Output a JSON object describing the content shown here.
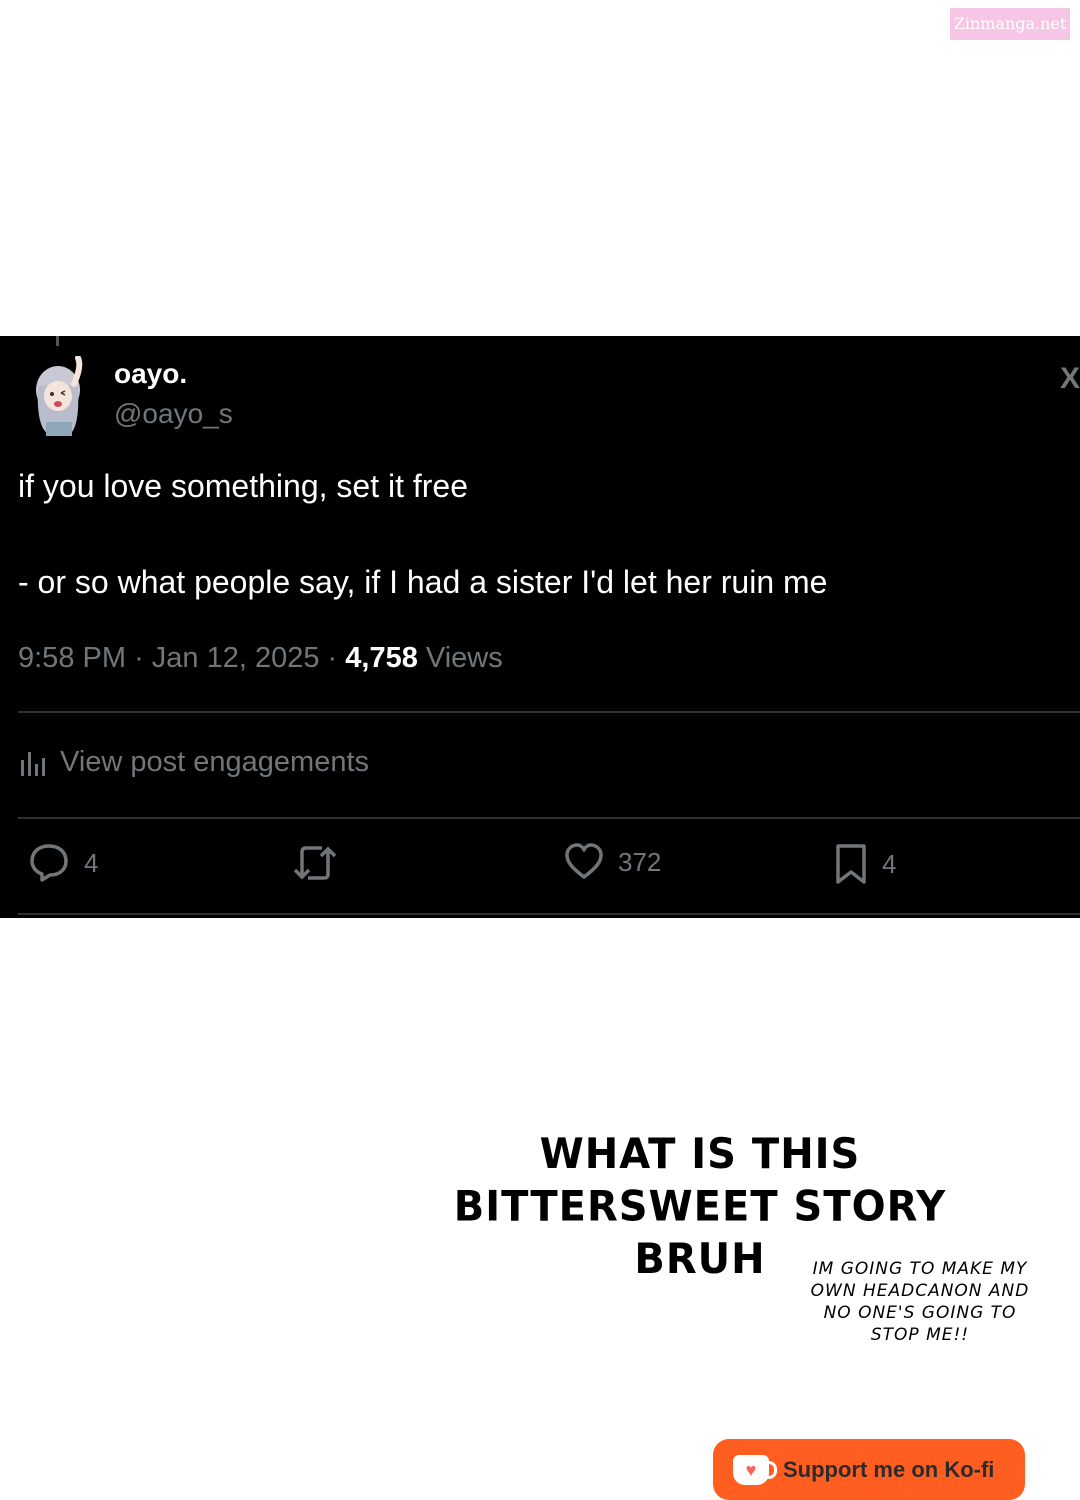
{
  "watermark": "Zinmanga.net",
  "tweet": {
    "display_name": "oayo.",
    "handle": "@oayo_s",
    "text_line1": "if you love something, set it free",
    "text_line2": "- or so what people say, if I had a sister I'd let her ruin me",
    "time": "9:58 PM",
    "date": "Jan 12, 2025",
    "views_count": "4,758",
    "views_label": "Views",
    "engagements_label": "View post engagements",
    "actions": {
      "replies": "4",
      "retweets": "",
      "likes": "372",
      "bookmarks": "4"
    }
  },
  "manga": {
    "big_text": "WHAT IS THIS BITTERSWEET STORY BRUH",
    "small_text": "IM GOING TO MAKE MY OWN HEADCANON AND NO ONE'S GOING TO STOP ME!!"
  },
  "kofi": {
    "label": "Support me on Ko-fi"
  },
  "colors": {
    "tweet_bg": "#000000",
    "muted": "#71767b",
    "kofi": "#ff5e20",
    "watermark_bg": "#f7c6e6"
  }
}
